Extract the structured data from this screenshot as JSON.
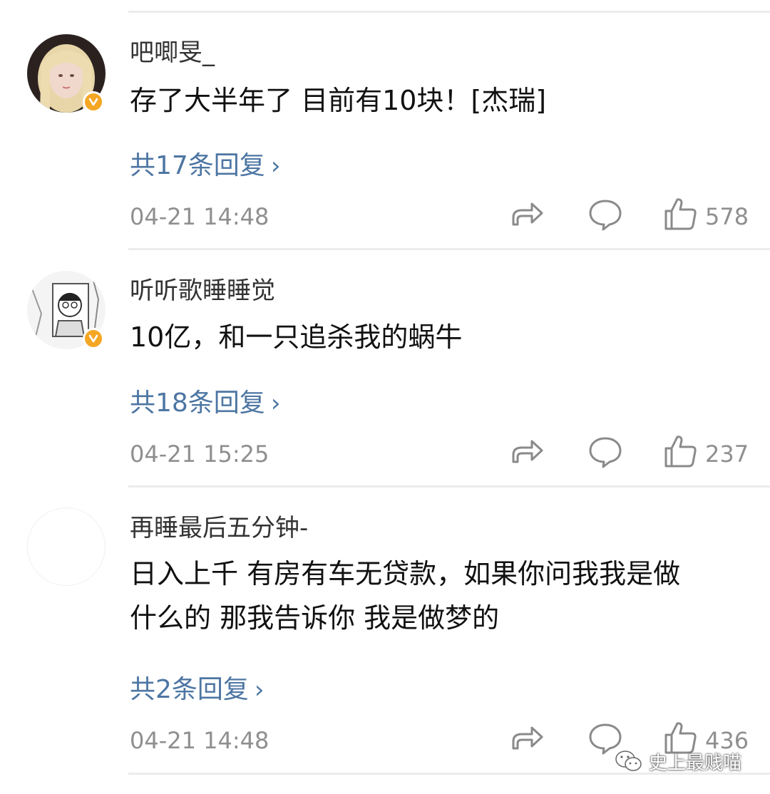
{
  "comments": [
    {
      "username": "吧唧旻_",
      "text_lines": [
        "存了大半年了 目前有10块！[杰瑞]"
      ],
      "replies_label": "共17条回复",
      "time": "04-21 14:48",
      "like_count": "578",
      "verified": true
    },
    {
      "username": "听听歌睡睡觉",
      "text_lines": [
        "10亿，和一只追杀我的蜗牛"
      ],
      "replies_label": "共18条回复",
      "time": "04-21 15:25",
      "like_count": "237",
      "verified": true
    },
    {
      "username": "再睡最后五分钟-",
      "text_lines": [
        "日入上千 有房有车无贷款，如果你问我我是做",
        "什么的 那我告诉你 我是做梦的"
      ],
      "replies_label": "共2条回复",
      "time": "04-21 14:48",
      "like_count": "436",
      "verified": false
    }
  ],
  "icons": {
    "share": "share-arrow-icon",
    "comment": "speech-bubble-icon",
    "like": "thumbs-up-icon",
    "chevron": "chevron-right-icon",
    "verified": "verified-v-badge-icon",
    "watermark": "wechat-logo-icon"
  },
  "colors": {
    "link": "#4d76a3",
    "muted": "#8f8f8f",
    "badge": "#f5a623",
    "divider": "#ececec"
  },
  "watermark": {
    "text": "史上最贱喵"
  }
}
